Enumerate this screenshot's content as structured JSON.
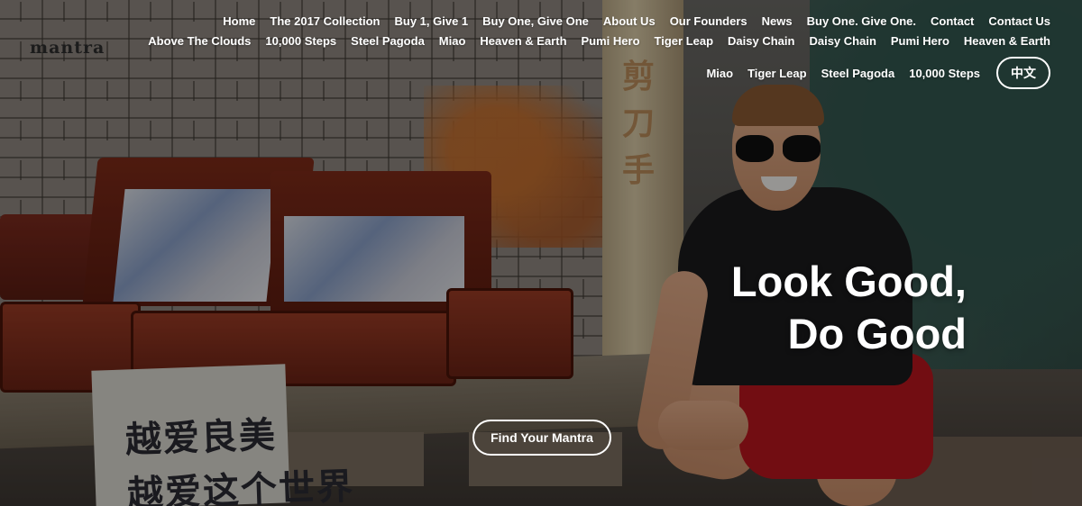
{
  "brand": {
    "logo_text": "mantra"
  },
  "nav": {
    "row1": [
      "Home",
      "The 2017 Collection",
      "Buy 1, Give 1",
      "Buy One, Give One",
      "About Us",
      "Our Founders",
      "News",
      "Buy One. Give One.",
      "Contact",
      "Contact Us"
    ],
    "row2": [
      "Above The Clouds",
      "10,000 Steps",
      "Steel Pagoda",
      "Miao",
      "Heaven & Earth",
      "Pumi Hero",
      "Tiger Leap",
      "Daisy Chain",
      "Daisy Chain",
      "Pumi Hero",
      "Heaven & Earth"
    ],
    "row3": [
      "Miao",
      "Tiger Leap",
      "Steel Pagoda",
      "10,000 Steps"
    ],
    "language_label": "中文"
  },
  "hero": {
    "headline_line1": "Look Good,",
    "headline_line2": "Do Good",
    "cta_label": "Find Your Mantra",
    "tote_text_line1": "越爱良美",
    "tote_text_line2": "越爱这个世界",
    "sign_text": "剪刀手"
  },
  "colors": {
    "nav_text": "#ffffff",
    "logo_text": "#1c1c1c",
    "shorts": "#b8161d",
    "shirt": "#1a1a1c"
  }
}
